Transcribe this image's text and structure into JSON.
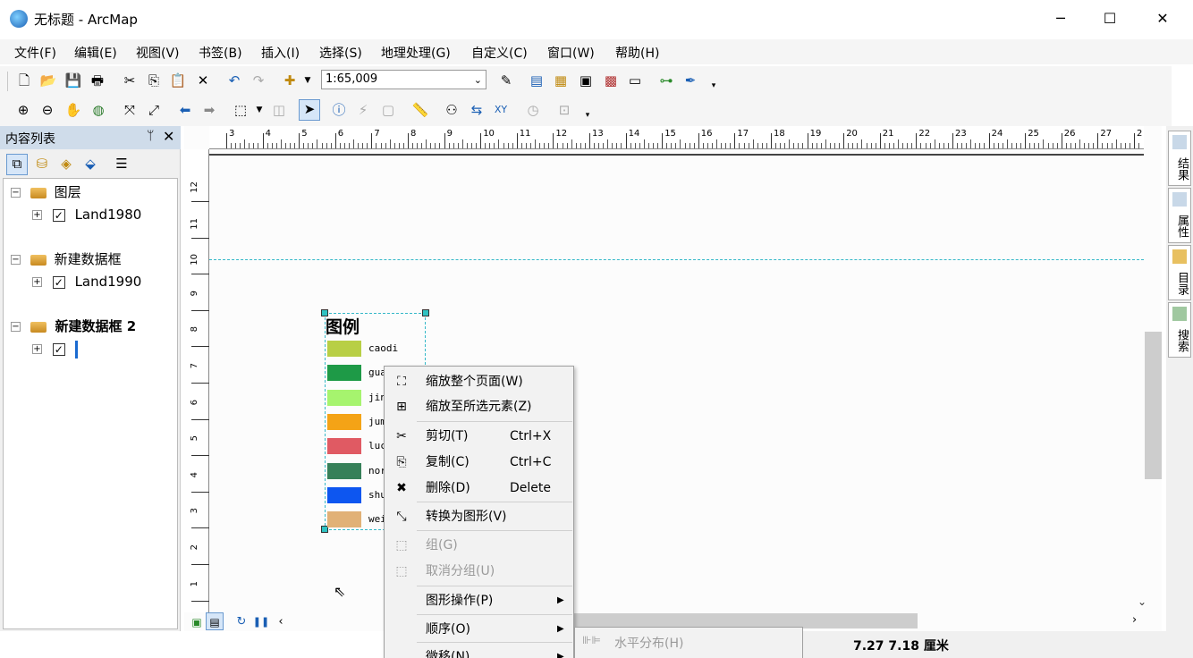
{
  "window": {
    "title": "无标题 - ArcMap",
    "minimize": "─",
    "maximize": "☐",
    "close": "✕"
  },
  "menubar": {
    "items": [
      "文件(F)",
      "编辑(E)",
      "视图(V)",
      "书签(B)",
      "插入(I)",
      "选择(S)",
      "地理处理(G)",
      "自定义(C)",
      "窗口(W)",
      "帮助(H)"
    ]
  },
  "toolbar": {
    "scale": "1:65,009"
  },
  "toc": {
    "title": "内容列表",
    "pin": "ᛘ",
    "close": "✕",
    "frames": [
      {
        "name": "图层",
        "layer": "Land1980"
      },
      {
        "name": "新建数据框",
        "layer": "Land1990"
      },
      {
        "name": "新建数据框 2",
        "layer": ""
      }
    ]
  },
  "rulers": {
    "top": [
      "3",
      "4",
      "5",
      "6",
      "7",
      "8",
      "9",
      "10",
      "11",
      "12",
      "13",
      "14",
      "15",
      "16",
      "17",
      "18",
      "19",
      "20",
      "21",
      "22",
      "23",
      "24",
      "25",
      "26",
      "27",
      "2"
    ],
    "left": [
      "12",
      "11",
      "10",
      "9",
      "8",
      "7",
      "6",
      "5",
      "4",
      "3",
      "2",
      "1"
    ]
  },
  "legend": {
    "title": "图例",
    "items": [
      {
        "label": "caodi",
        "color": "#b8cf45"
      },
      {
        "label": "gua",
        "color": "#1e9a47"
      },
      {
        "label": "jin",
        "color": "#a6f46e"
      },
      {
        "label": "jum",
        "color": "#f4a316"
      },
      {
        "label": "luc",
        "color": "#e05a63"
      },
      {
        "label": "nor",
        "color": "#368059"
      },
      {
        "label": "shu",
        "color": "#0d56f0"
      },
      {
        "label": "wei",
        "color": "#e1b177"
      }
    ]
  },
  "context_menu": {
    "items": [
      {
        "icon": "⛶",
        "label": "缩放整个页面(W)",
        "shortcut": "",
        "submenu": false,
        "disabled": false
      },
      {
        "icon": "⊞",
        "label": "缩放至所选元素(Z)",
        "shortcut": "",
        "submenu": false,
        "disabled": false
      },
      {
        "icon": "✂",
        "label": "剪切(T)",
        "shortcut": "Ctrl+X",
        "submenu": false,
        "disabled": false
      },
      {
        "icon": "⎘",
        "label": "复制(C)",
        "shortcut": "Ctrl+C",
        "submenu": false,
        "disabled": false
      },
      {
        "icon": "✖",
        "label": "删除(D)",
        "shortcut": "Delete",
        "submenu": false,
        "disabled": false
      },
      {
        "icon": "⤡",
        "label": "转换为图形(V)",
        "shortcut": "",
        "submenu": false,
        "disabled": false
      },
      {
        "icon": "⬚",
        "label": "组(G)",
        "shortcut": "",
        "submenu": false,
        "disabled": true
      },
      {
        "icon": "⬚",
        "label": "取消分组(U)",
        "shortcut": "",
        "submenu": false,
        "disabled": true
      },
      {
        "icon": "",
        "label": "图形操作(P)",
        "shortcut": "",
        "submenu": true,
        "disabled": false
      },
      {
        "icon": "",
        "label": "顺序(O)",
        "shortcut": "",
        "submenu": true,
        "disabled": false
      },
      {
        "icon": "",
        "label": "微移(N)",
        "shortcut": "",
        "submenu": true,
        "disabled": false
      }
    ],
    "submenu_arrow": "▶"
  },
  "submenu": {
    "item": "水平分布(H)"
  },
  "right_tabs": [
    "结果",
    "属性",
    "目录",
    "搜索"
  ],
  "status": {
    "coords": "7.27  7.18 厘米"
  }
}
